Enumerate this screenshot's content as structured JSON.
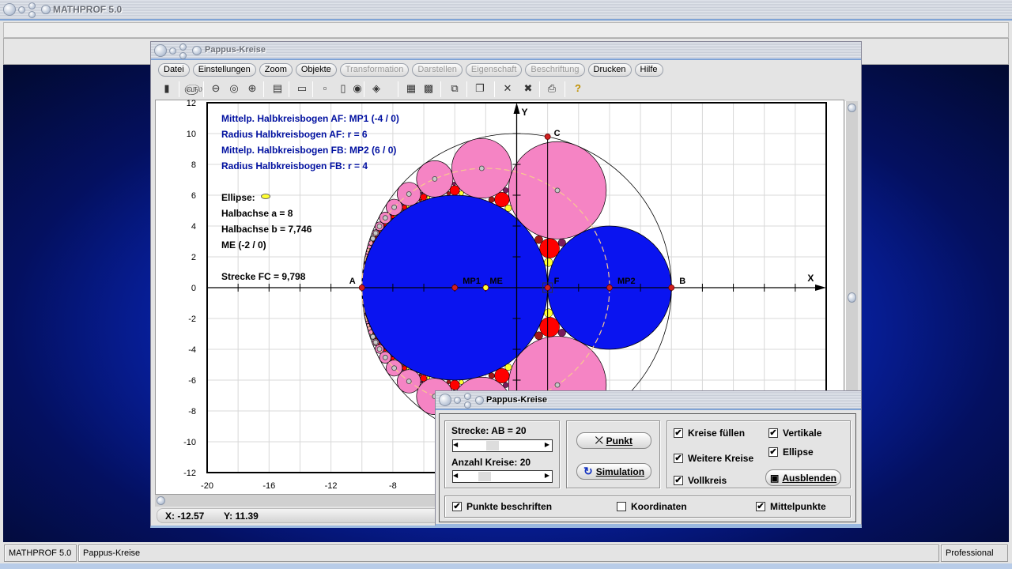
{
  "app": {
    "title": "MATHPROF 5.0"
  },
  "window": {
    "title": "Pappus-Kreise",
    "menu": [
      {
        "label": "Datei",
        "enabled": true
      },
      {
        "label": "Einstellungen",
        "enabled": true
      },
      {
        "label": "Zoom",
        "enabled": true
      },
      {
        "label": "Objekte",
        "enabled": true
      },
      {
        "label": "Transformation",
        "enabled": false
      },
      {
        "label": "Darstellen",
        "enabled": false
      },
      {
        "label": "Eigenschaft",
        "enabled": false
      },
      {
        "label": "Beschriftung",
        "enabled": false
      },
      {
        "label": "Drucken",
        "enabled": true
      },
      {
        "label": "Hilfe",
        "enabled": true
      }
    ],
    "toolbar": [
      {
        "icon": "window-icon",
        "glyph": "▮"
      },
      {
        "icon": "glasses-icon",
        "glyph": "௵"
      },
      {
        "icon": "zoom-out-icon",
        "glyph": "⊖"
      },
      {
        "icon": "zoom-reset-icon",
        "glyph": "◎"
      },
      {
        "icon": "zoom-in-icon",
        "glyph": "⊕"
      },
      {
        "icon": "properties-icon",
        "glyph": "▤"
      },
      {
        "icon": "layout-icon",
        "glyph": "▭"
      },
      {
        "icon": "frame-small-icon",
        "glyph": "▫"
      },
      {
        "icon": "frame-double-icon",
        "glyph": "▯"
      },
      {
        "icon": "point-icon",
        "glyph": "◉"
      },
      {
        "icon": "point-set-icon",
        "glyph": "◈"
      },
      {
        "icon": "table-icon",
        "glyph": "▦"
      },
      {
        "icon": "export-icon",
        "glyph": "▩"
      },
      {
        "icon": "copy-icon",
        "glyph": "⧉"
      },
      {
        "icon": "pages-icon",
        "glyph": "❐"
      },
      {
        "icon": "delete-icon",
        "glyph": "✕"
      },
      {
        "icon": "delete-all-icon",
        "glyph": "✖"
      },
      {
        "icon": "print-icon",
        "glyph": "⎙"
      },
      {
        "icon": "help-icon",
        "glyph": "?"
      }
    ],
    "coords": {
      "x": "X: -12.57",
      "y": "Y: 11.39"
    }
  },
  "info": {
    "lines_blue": [
      "Mittelp. Halbkreisbogen AF: MP1 (-4 / 0)",
      "Radius Halbkreisbogen AF: r = 6",
      "Mittelp. Halbkreisbogen FB: MP2 (6 / 0)",
      "Radius Halbkreisbogen FB: r = 4"
    ],
    "ellipse_label": "Ellipse:",
    "lines_black": [
      "Halbachse a = 8",
      "Halbachse b = 7,746",
      "ME (-2 / 0)"
    ],
    "strecke": "Strecke FC = 9,798"
  },
  "plot": {
    "xlim": [
      -20,
      20
    ],
    "ylim": [
      -12,
      12
    ],
    "grid_step": 2,
    "grid": true,
    "x_ticks": [
      "-20",
      "-16",
      "-12",
      "-8"
    ],
    "y_ticks": [
      "12",
      "10",
      "8",
      "6",
      "4",
      "2",
      "0",
      "-2",
      "-4",
      "-6",
      "-8",
      "-10",
      "-12"
    ],
    "axis_x": "X",
    "axis_y": "Y",
    "outer_circle": {
      "cx": 0,
      "cy": 0,
      "r": 10
    },
    "circle_AF": {
      "cx": -4,
      "cy": 0,
      "r": 6
    },
    "circle_FB": {
      "cx": 6,
      "cy": 0,
      "r": 4
    },
    "ellipse": {
      "cx": -2,
      "cy": 0,
      "a": 8,
      "b": 7.746
    },
    "chain_count": 20,
    "points": [
      {
        "name": "A",
        "x": -10,
        "y": 0
      },
      {
        "name": "MP1",
        "x": -4,
        "y": 0
      },
      {
        "name": "ME",
        "x": -2,
        "y": 0
      },
      {
        "name": "F",
        "x": 2,
        "y": 0
      },
      {
        "name": "MP2",
        "x": 6,
        "y": 0
      },
      {
        "name": "B",
        "x": 10,
        "y": 0
      },
      {
        "name": "C",
        "x": 2,
        "y": 9.798
      }
    ],
    "colors": {
      "blue": "#0a14f0",
      "pink": "#f584c4",
      "red": "#ff0000",
      "darkred": "#a01818",
      "purple": "#7a1c5c",
      "yellow": "#ffff30",
      "ellipse": "#f7c890"
    }
  },
  "dialog": {
    "title": "Pappus-Kreise",
    "strecke": "Strecke:  AB = 20",
    "anzahl": "Anzahl Kreise:  20",
    "punkt": "Punkt",
    "simulation": "Simulation",
    "ausblenden": "Ausblenden",
    "checks": [
      {
        "label": "Kreise füllen",
        "checked": true
      },
      {
        "label": "Weitere Kreise",
        "checked": true
      },
      {
        "label": "Vollkreis",
        "checked": true
      },
      {
        "label": "Vertikale",
        "checked": true
      },
      {
        "label": "Ellipse",
        "checked": true
      },
      {
        "label": "Punkte beschriften",
        "checked": true
      },
      {
        "label": "Koordinaten",
        "checked": false
      },
      {
        "label": "Mittelpunkte",
        "checked": true
      }
    ]
  },
  "status": {
    "app": "MATHPROF 5.0",
    "doc": "Pappus-Kreise",
    "edition": "Professional"
  }
}
